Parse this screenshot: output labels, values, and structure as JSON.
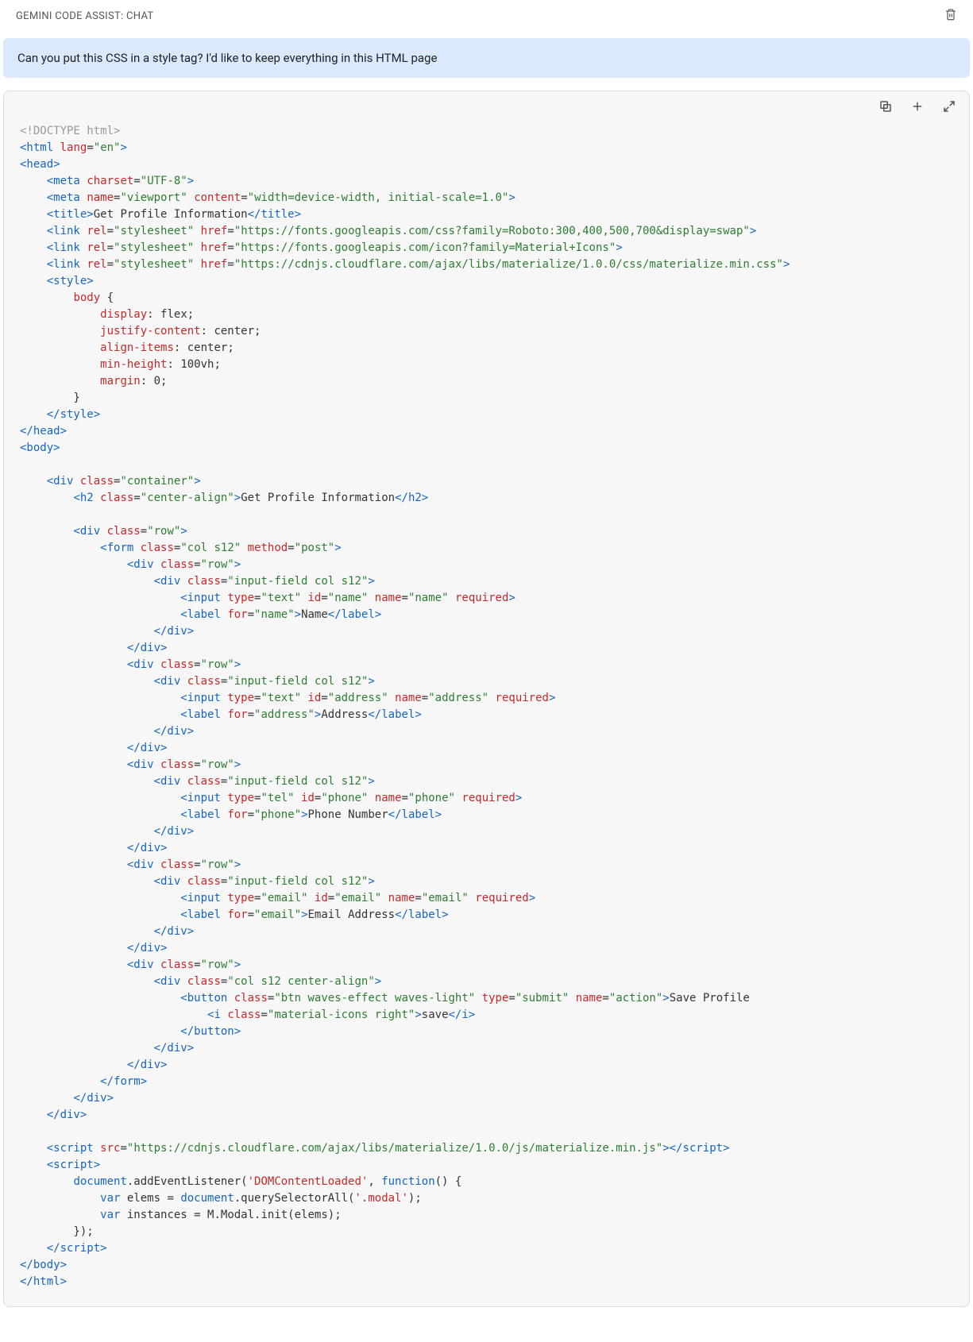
{
  "header": {
    "title": "GEMINI CODE ASSIST: CHAT"
  },
  "user_message": "Can you put this CSS in a style tag? I'd like to keep everything in this HTML page",
  "code": {
    "doctype": "<!DOCTYPE html>",
    "html_lang": "en",
    "meta_charset": "UTF-8",
    "viewport_content": "width=device-width, initial-scale=1.0",
    "title": "Get Profile Information",
    "link1_href": "https://fonts.googleapis.com/css?family=Roboto:300,400,500,700&display=swap",
    "link2_href": "https://fonts.googleapis.com/icon?family=Material+Icons",
    "link3_href": "https://cdnjs.cloudflare.com/ajax/libs/materialize/1.0.0/css/materialize.min.css",
    "style_body": {
      "display": "flex",
      "justify_content": "center",
      "align_items": "center",
      "min_height": "100vh",
      "margin": "0"
    },
    "h2_text": "Get Profile Information",
    "fields": {
      "name_label": "Name",
      "address_label": "Address",
      "phone_label": "Phone Number",
      "email_label": "Email Address"
    },
    "button_text": "Save Profile",
    "icon_text": "save",
    "script_src": "https://cdnjs.cloudflare.com/ajax/libs/materialize/1.0.0/js/materialize.min.js",
    "js": {
      "event": "DOMContentLoaded",
      "sel": ".modal",
      "init": "M.Modal.init(elems)"
    }
  }
}
